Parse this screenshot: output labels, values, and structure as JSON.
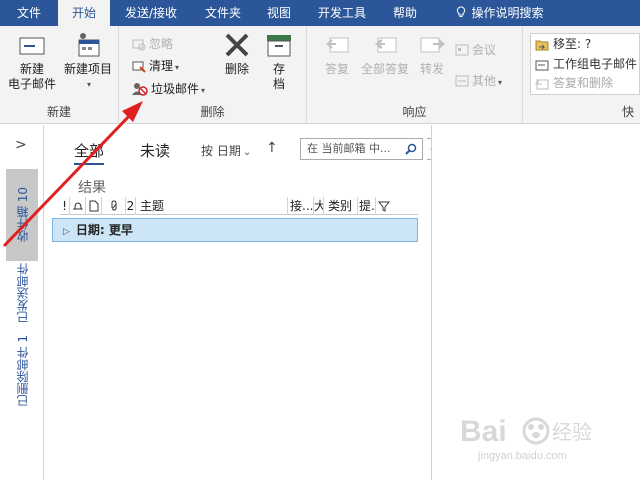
{
  "tabs": [
    "文件",
    "开始",
    "发送/接收",
    "文件夹",
    "视图",
    "开发工具",
    "帮助",
    "操作说明搜索"
  ],
  "ribbon": {
    "new_group": {
      "label": "新建",
      "new_email": [
        "新建",
        "电子邮件"
      ],
      "new_items": "新建项目"
    },
    "delete_group": {
      "label": "删除",
      "ignore": "忽略",
      "clean": "清理",
      "junk": "垃圾邮件",
      "delete": "删除",
      "archive": [
        "存",
        "档"
      ]
    },
    "respond_group": {
      "label": "响应",
      "reply": "答复",
      "reply_all": "全部答复",
      "forward": "转发",
      "meeting": "会议",
      "more": "其他"
    },
    "quicksteps_group": {
      "label": "快",
      "move_to": "移至: ?",
      "team_email": "工作组电子邮件",
      "reply_delete": "答复和删除"
    }
  },
  "nav": {
    "collapse_glyph": ">",
    "inbox": "收件箱  10",
    "sent": "已发送邮件",
    "deleted": "已删除邮件  1"
  },
  "list": {
    "filters": {
      "all": "全部",
      "unread": "未读"
    },
    "sort": "按 日期",
    "sort_arrow": "↑",
    "search_placeholder": "在 当前邮箱 中...",
    "results": "结果",
    "columns": [
      "!",
      "",
      "",
      "",
      "2",
      "主题",
      "接...",
      "大",
      "类别",
      "提.",
      ""
    ],
    "group_header": "日期: 更早"
  },
  "watermark": {
    "brand": "Bai",
    "brand2": "经验",
    "url": "jingyan.baidu.com"
  },
  "colors": {
    "accent": "#2b579a",
    "ribbon_bg": "#f3f3f3",
    "selection": "#cde6f7",
    "arrow": "#e02020"
  }
}
